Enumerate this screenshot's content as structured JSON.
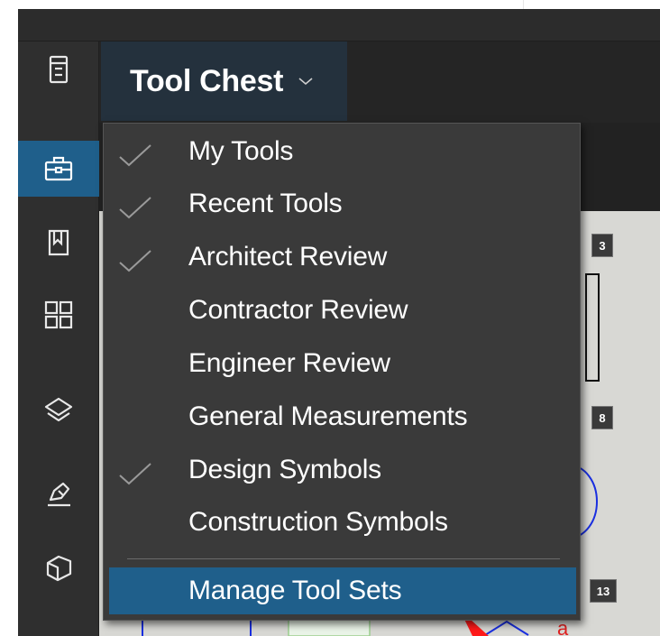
{
  "header": {
    "title": "Tool Chest"
  },
  "sidebar": {
    "items": [
      {
        "icon": "document-list-icon",
        "active": false
      },
      {
        "icon": "toolbox-icon",
        "active": true
      },
      {
        "icon": "bookmark-icon",
        "active": false
      },
      {
        "icon": "thumbnails-grid-icon",
        "active": false
      },
      {
        "icon": "layers-icon",
        "active": false
      },
      {
        "icon": "signature-pen-icon",
        "active": false
      },
      {
        "icon": "3d-shape-icon",
        "active": false
      }
    ]
  },
  "menu": {
    "items": [
      {
        "label": "My Tools",
        "checked": true
      },
      {
        "label": "Recent Tools",
        "checked": true
      },
      {
        "label": "Architect Review",
        "checked": true
      },
      {
        "label": "Contractor Review",
        "checked": false
      },
      {
        "label": "Engineer Review",
        "checked": false
      },
      {
        "label": "General Measurements",
        "checked": false
      },
      {
        "label": "Design Symbols",
        "checked": true
      },
      {
        "label": "Construction Symbols",
        "checked": false
      }
    ],
    "manage_label": "Manage Tool Sets"
  },
  "canvas": {
    "page_labels": [
      "3",
      "8",
      "13"
    ],
    "annotation_letter": "a"
  },
  "colors": {
    "accent": "#1f5f8b",
    "menu_bg": "#3a3a3a",
    "sidebar_bg": "#2f2f2f",
    "header_btn_bg": "#24313d"
  }
}
